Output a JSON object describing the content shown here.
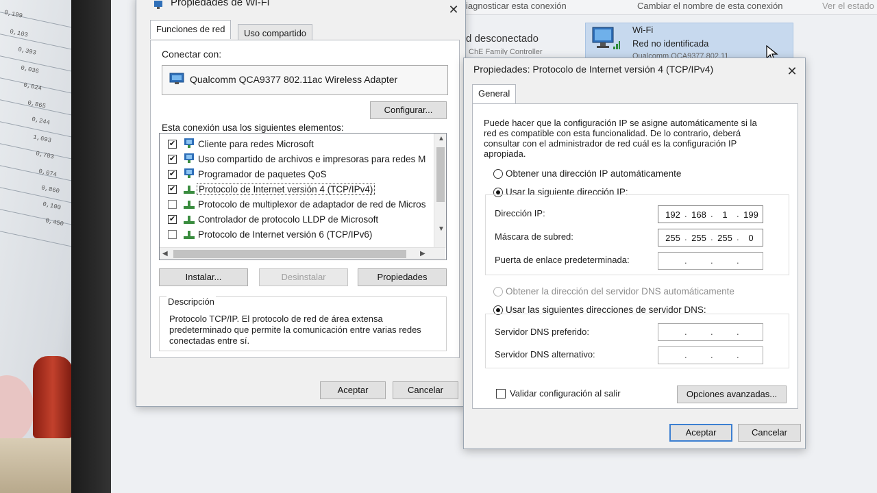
{
  "bg_window": {
    "toolbar_items": [
      "iagnosticar esta conexión",
      "Cambiar el nombre de esta conexión",
      "Ver el estado"
    ],
    "connection_status": "d desconectado",
    "connection_sub": "ChE Family Controller",
    "wifi": {
      "name": "Wi-Fi",
      "status": "Red no identificada",
      "adapter": "Qualcomm QCA9377 802.11"
    }
  },
  "wifi_props": {
    "title": "Propiedades de Wi-Fi",
    "close": "✕",
    "tabs": [
      "Funciones de red",
      "Uso compartido"
    ],
    "connect_label": "Conectar con:",
    "adapter": "Qualcomm QCA9377 802.11ac Wireless Adapter",
    "configure_btn": "Configurar...",
    "items_label": "Esta conexión usa los siguientes elementos:",
    "items": [
      {
        "label": "Cliente para redes Microsoft",
        "checked": true,
        "icon": "network-client-icon"
      },
      {
        "label": "Uso compartido de archivos e impresoras para redes M",
        "checked": true,
        "icon": "network-client-icon"
      },
      {
        "label": "Programador de paquetes QoS",
        "checked": true,
        "icon": "network-client-icon"
      },
      {
        "label": "Protocolo de Internet versión 4 (TCP/IPv4)",
        "checked": true,
        "icon": "protocol-icon"
      },
      {
        "label": "Protocolo de multiplexor de adaptador de red de Micros",
        "checked": false,
        "icon": "protocol-icon"
      },
      {
        "label": "Controlador de protocolo LLDP de Microsoft",
        "checked": true,
        "icon": "protocol-icon"
      },
      {
        "label": "Protocolo de Internet versión 6 (TCP/IPv6)",
        "checked": false,
        "icon": "protocol-icon"
      }
    ],
    "install_btn": "Instalar...",
    "uninstall_btn": "Desinstalar",
    "properties_btn": "Propiedades",
    "description_label": "Descripción",
    "description_text": "Protocolo TCP/IP. El protocolo de red de área extensa predeterminado que permite la comunicación entre varias redes conectadas entre sí.",
    "ok_btn": "Aceptar",
    "cancel_btn": "Cancelar"
  },
  "ipv4_props": {
    "title": "Propiedades: Protocolo de Internet versión 4 (TCP/IPv4)",
    "close": "✕",
    "tab": "General",
    "intro": "Puede hacer que la configuración IP se asigne automáticamente si la red es compatible con esta funcionalidad. De lo contrario, deberá consultar con el administrador de red cuál es la configuración IP apropiada.",
    "auto_ip": "Obtener una dirección IP automáticamente",
    "manual_ip": "Usar la siguiente dirección IP:",
    "ip_label": "Dirección IP:",
    "ip_value": [
      "192",
      "168",
      "1",
      "199"
    ],
    "mask_label": "Máscara de subred:",
    "mask_value": [
      "255",
      "255",
      "255",
      "0"
    ],
    "gateway_label": "Puerta de enlace predeterminada:",
    "auto_dns": "Obtener la dirección del servidor DNS automáticamente",
    "manual_dns": "Usar las siguientes direcciones de servidor DNS:",
    "dns_pref_label": "Servidor DNS preferido:",
    "dns_alt_label": "Servidor DNS alternativo:",
    "validate_label": "Validar configuración al salir",
    "advanced_btn": "Opciones avanzadas...",
    "ok_btn": "Aceptar",
    "cancel_btn": "Cancelar"
  },
  "photo": {
    "paper_numbers": [
      "0,199",
      "0,103",
      "0,393",
      "0,036",
      "0,624",
      "0,865",
      "0,244",
      "1,693",
      "0,703",
      "0,074",
      "0,860",
      "0,100",
      "0,450"
    ]
  }
}
